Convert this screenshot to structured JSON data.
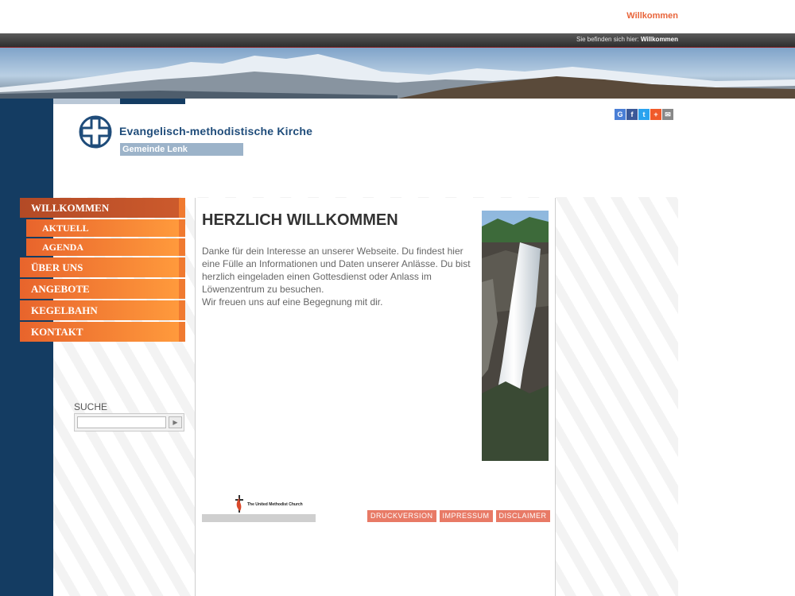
{
  "top": {
    "welcome_link": "Willkommen"
  },
  "breadcrumb": {
    "prefix": "Sie befinden sich hier:",
    "current": "Willkommen"
  },
  "logo": {
    "title": "Evangelisch-methodistische Kirche",
    "subtitle": "Gemeinde Lenk"
  },
  "share": [
    {
      "label": "G",
      "color": "#4a7fd6",
      "icon": "google-icon"
    },
    {
      "label": "f",
      "color": "#3b5998",
      "icon": "facebook-icon"
    },
    {
      "label": "t",
      "color": "#2aa3ef",
      "icon": "twitter-icon"
    },
    {
      "label": "+",
      "color": "#f05a2a",
      "icon": "plus-icon"
    },
    {
      "label": "✉",
      "color": "#888888",
      "icon": "mail-icon"
    }
  ],
  "nav": [
    {
      "label": "WILLKOMMEN",
      "active": true,
      "sub": false
    },
    {
      "label": "AKTUELL",
      "active": false,
      "sub": true
    },
    {
      "label": "AGENDA",
      "active": false,
      "sub": true
    },
    {
      "label": "ÜBER UNS",
      "active": false,
      "sub": false
    },
    {
      "label": "ANGEBOTE",
      "active": false,
      "sub": false
    },
    {
      "label": "KEGELBAHN",
      "active": false,
      "sub": false
    },
    {
      "label": "KONTAKT",
      "active": false,
      "sub": false
    }
  ],
  "content": {
    "title": "HERZLICH WILLKOMMEN",
    "paragraph1": "Danke für dein Interesse an unserer Webseite. Du findest hier eine Fülle an Informationen und Daten unserer Anlässe. Du bist herzlich eingeladen einen Gottesdienst oder Anlass im Löwenzentrum zu besuchen.",
    "paragraph2": "Wir freuen uns auf eine Begegnung mit dir."
  },
  "umc_logo_text": "The United Methodist Church",
  "footer": {
    "print": "DRUCKVERSION",
    "imprint": "IMPRESSUM",
    "disclaimer": "DISCLAIMER"
  },
  "search": {
    "label": "SUCHE",
    "value": "",
    "button_icon": "arrow-right-icon"
  },
  "colors": {
    "accent": "#e8643a",
    "navy": "#143c62",
    "nav_orange": "#ff8c34"
  }
}
